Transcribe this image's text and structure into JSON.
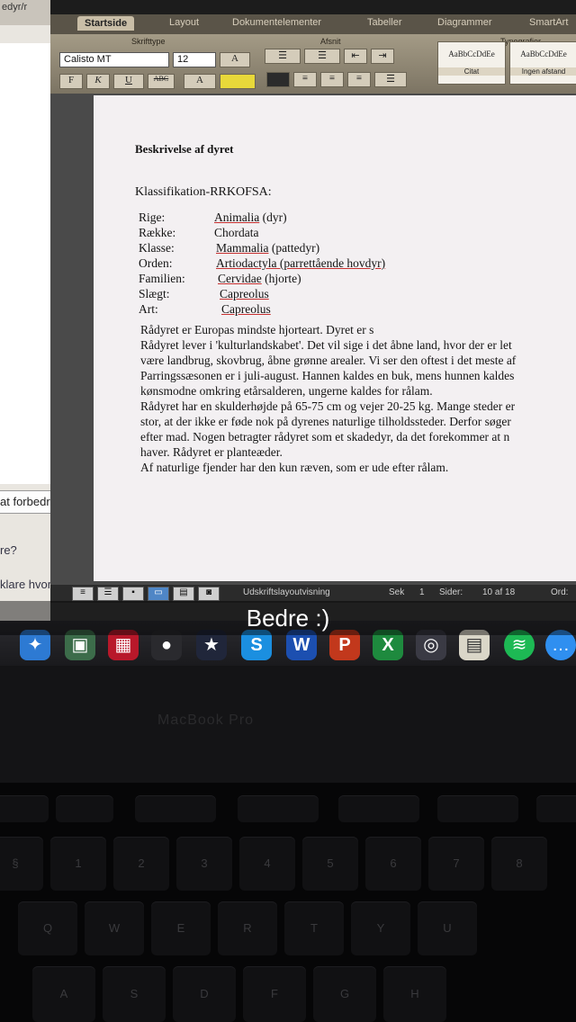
{
  "background_window": {
    "address_text": "edyr/r",
    "button_label": "at forbedre",
    "lines": [
      "re?",
      "klare hvor"
    ]
  },
  "word": {
    "tabs": [
      {
        "label": "Startside",
        "active": true
      },
      {
        "label": "Layout",
        "active": false
      },
      {
        "label": "Dokumentelementer",
        "active": false
      },
      {
        "label": "Tabeller",
        "active": false
      },
      {
        "label": "Diagrammer",
        "active": false
      },
      {
        "label": "SmartArt",
        "active": false
      }
    ],
    "ribbon": {
      "group_font": "Skrifttype",
      "group_paragraph": "Afsnit",
      "group_styles": "Typografier",
      "font_name": "Calisto MT",
      "font_size": "12",
      "bold": "F",
      "italic": "K",
      "underline": "U",
      "strike": "ABC",
      "style_preview": "AaBbCcDdEe",
      "style_1": "Citat",
      "style_2": "Ingen afstand"
    },
    "document": {
      "heading": "Beskrivelse af dyret",
      "classification_title": "Klassifikation-RRKOFSA:",
      "taxonomy": [
        {
          "label": "Rige:",
          "value": "Animalia",
          "suffix": " (dyr)"
        },
        {
          "label": "Række:",
          "value": "Chordata",
          "suffix": ""
        },
        {
          "label": "Klasse:",
          "value": "Mammalia",
          "suffix": " (pattedyr)"
        },
        {
          "label": "Orden:",
          "value": "Artiodactyla",
          "suffix": " (parrettående hovdyr)"
        },
        {
          "label": "Familien:",
          "value": "Cervidae",
          "suffix": " (hjorte)"
        },
        {
          "label": "Slægt:",
          "value": "Capreolus",
          "suffix": ""
        },
        {
          "label": "Art:",
          "value": "Capreolus",
          "suffix": ""
        }
      ],
      "paragraph_lines": [
        "Rådyret er Europas mindste hjorteart. Dyret er s",
        "Rådyret lever i 'kulturlandskabet'. Det vil sige i det åbne land, hvor der er let",
        "være landbrug, skovbrug, åbne grønne arealer. Vi ser den oftest i det meste af",
        "Parringssæsonen er i juli-august. Hannen kaldes en buk, mens hunnen kaldes",
        "kønsmodne omkring etårsalderen, ungerne kaldes for rålam.",
        "Rådyret har en skulderhøjde på 65-75 cm og vejer 20-25 kg. Mange steder er",
        "stor, at der ikke er føde nok på dyrenes naturlige tilholdssteder. Derfor søger",
        "efter mad. Nogen betragter rådyret som et skadedyr, da det forekommer at n",
        "haver. Rådyret er planteæder.",
        "Af naturlige fjender har den kun ræven, som er ude efter rålam."
      ]
    },
    "statusbar": {
      "view_label": "Udskriftslayoutvisning",
      "section_label": "Sek",
      "section_value": "1",
      "pages_label": "Sider:",
      "pages_value": "10 af 18",
      "words_label": "Ord:"
    }
  },
  "overlay_caption": "Bedre :)",
  "laptop_brand": "MacBook Pro",
  "dock_icons": [
    "safari-icon",
    "photo-icon",
    "photo-booth-icon",
    "facetime-icon",
    "imovie-icon",
    "skype-icon",
    "word-icon",
    "powerpoint-icon",
    "excel-icon",
    "network-icon",
    "preview-icon",
    "spotify-icon",
    "messages-icon"
  ],
  "keyboard_keys": [
    "§",
    "1",
    "2",
    "3",
    "4",
    "5",
    "6",
    "7",
    "8",
    "Q",
    "W",
    "E",
    "R",
    "T",
    "Y",
    "U",
    "A",
    "S",
    "D",
    "F",
    "G",
    "H"
  ],
  "colors": {
    "spell_underline": "#c63030",
    "active_view": "#4f86c6",
    "ribbon": "#a49b86"
  }
}
